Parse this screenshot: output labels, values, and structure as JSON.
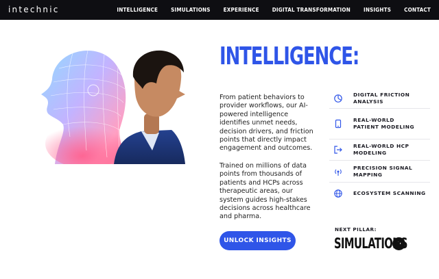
{
  "brand": {
    "logo_text": "intechnic"
  },
  "nav": {
    "items": [
      {
        "label": "INTELLIGENCE"
      },
      {
        "label": "SIMULATIONS"
      },
      {
        "label": "EXPERIENCE"
      },
      {
        "label": "DIGITAL TRANSFORMATION"
      },
      {
        "label": "INSIGHTS"
      },
      {
        "label": "CONTACT"
      }
    ]
  },
  "hero": {
    "heading": "INTELLIGENCE:",
    "paragraph_1": "From patient behaviors to provider workflows, our AI-powered intelligence identifies unmet needs, decision drivers, and friction points that directly impact engagement and outcomes.",
    "paragraph_2": "Trained on millions of data points from thousands of patients and HCPs across therapeutic areas, our system guides high-stakes decisions across healthcare and pharma.",
    "cta_label": "UNLOCK INSIGHTS"
  },
  "features": [
    {
      "label": "DIGITAL FRICTION ANALYSIS",
      "icon": "pie-chart-icon"
    },
    {
      "label": "REAL-WORLD PATIENT MODELING",
      "icon": "phone-icon"
    },
    {
      "label": "REAL-WORLD HCP MODELING",
      "icon": "exit-arrow-icon"
    },
    {
      "label": "PRECISION SIGNAL MAPPING",
      "icon": "signal-icon"
    },
    {
      "label": "ECOSYSTEM SCANNING",
      "icon": "globe-icon"
    }
  ],
  "next_pillar": {
    "label": "NEXT PILLAR:",
    "title": "SIMULATIONS"
  },
  "colors": {
    "accent": "#2f55e8",
    "nav_bg": "#0e0e12",
    "text": "#111111"
  }
}
